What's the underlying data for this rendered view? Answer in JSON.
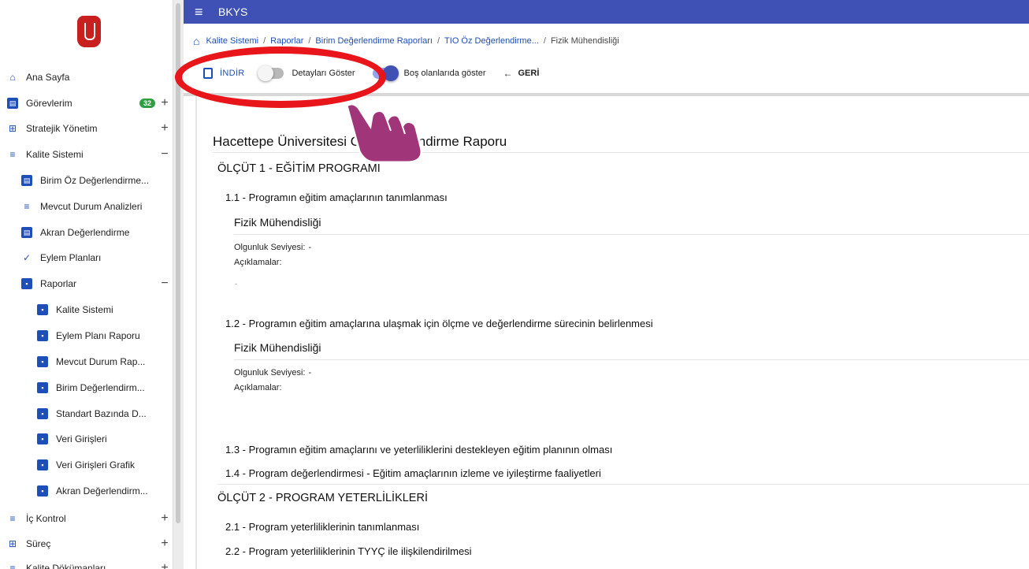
{
  "app": {
    "title": "BKYS"
  },
  "sidebar": {
    "items": [
      {
        "label": "Ana Sayfa",
        "icon": "home-icon"
      },
      {
        "label": "Görevlerim",
        "icon": "tasks-icon",
        "badge": "32",
        "expander": "+"
      },
      {
        "label": "Stratejik Yönetim",
        "icon": "strategy-icon",
        "expander": "+"
      },
      {
        "label": "Kalite Sistemi",
        "icon": "list-icon",
        "expander": "−"
      },
      {
        "label": "Birim Öz Değerlendirme...",
        "icon": "clipboard-icon"
      },
      {
        "label": "Mevcut Durum Analizleri",
        "icon": "list-icon"
      },
      {
        "label": "Akran Değerlendirme",
        "icon": "clipboard-icon"
      },
      {
        "label": "Eylem Planları",
        "icon": "action-plan-icon"
      },
      {
        "label": "Raporlar",
        "icon": "report-folder-icon",
        "expander": "−"
      },
      {
        "label": "Kalite Sistemi",
        "icon": "report-icon"
      },
      {
        "label": "Eylem Planı Raporu",
        "icon": "report-icon"
      },
      {
        "label": "Mevcut Durum Rap...",
        "icon": "report-icon"
      },
      {
        "label": "Birim Değerlendirm...",
        "icon": "report-icon"
      },
      {
        "label": "Standart Bazında D...",
        "icon": "report-icon"
      },
      {
        "label": "Veri Girişleri",
        "icon": "report-icon"
      },
      {
        "label": "Veri Girişleri Grafik",
        "icon": "report-icon"
      },
      {
        "label": "Akran Değerlendirm...",
        "icon": "report-icon"
      },
      {
        "label": "İç Kontrol",
        "icon": "list-icon",
        "expander": "+"
      },
      {
        "label": "Süreç",
        "icon": "strategy-icon",
        "expander": "+"
      },
      {
        "label": "Kalite Dökümanları",
        "icon": "list-icon",
        "expander": "+"
      }
    ]
  },
  "breadcrumb": {
    "items": [
      "Kalite Sistemi",
      "Raporlar",
      "Birim Değerlendirme Raporları",
      "TIO Öz Değerlendirme...",
      "Fizik Mühendisliği"
    ],
    "separator": "/"
  },
  "toolbar": {
    "download_label": "İNDİR",
    "toggle_details_label": "Detayları Göster",
    "toggle_details_on": false,
    "toggle_empty_label": "Boş olanlarıda göster",
    "toggle_empty_on": true,
    "back_label": "GERİ"
  },
  "annotation": {
    "color": "#e8151b",
    "hand_color": "#a0357a"
  },
  "colors": {
    "accent": "#3f51b5",
    "link": "#1e4eb8",
    "badge": "#2f9e44"
  },
  "report": {
    "title": "Hacettepe Üniversitesi Öz Değerlendirme Raporu",
    "criteria": [
      {
        "title": "ÖLÇÜT 1 - EĞİTİM PROGRAMI",
        "items": [
          {
            "title": "1.1 - Programın eğitim amaçlarının tanımlanması",
            "unit": "Fizik Mühendisliği",
            "maturity_label": "Olgunluk Seviyesi:",
            "maturity_value": "-",
            "notes_label": "Açıklamalar:"
          },
          {
            "title": "1.2 - Programın eğitim amaçlarına ulaşmak için ölçme ve değerlendirme sürecinin belirlenmesi",
            "unit": "Fizik Mühendisliği",
            "maturity_label": "Olgunluk Seviyesi:",
            "maturity_value": "-",
            "notes_label": "Açıklamalar:"
          },
          {
            "title": "1.3 - Programın eğitim amaçlarını ve yeterliliklerini destekleyen eğitim planının olması"
          },
          {
            "title": "1.4 - Program değerlendirmesi - Eğitim amaçlarının izleme ve iyileştirme faaliyetleri"
          }
        ]
      },
      {
        "title": "ÖLÇÜT 2 - PROGRAM YETERLİLİKLERİ",
        "items": [
          {
            "title": "2.1 - Program yeterliliklerinin tanımlanması"
          },
          {
            "title": "2.2 - Program yeterliliklerinin TYYÇ ile ilişkilendirilmesi"
          }
        ]
      }
    ]
  }
}
